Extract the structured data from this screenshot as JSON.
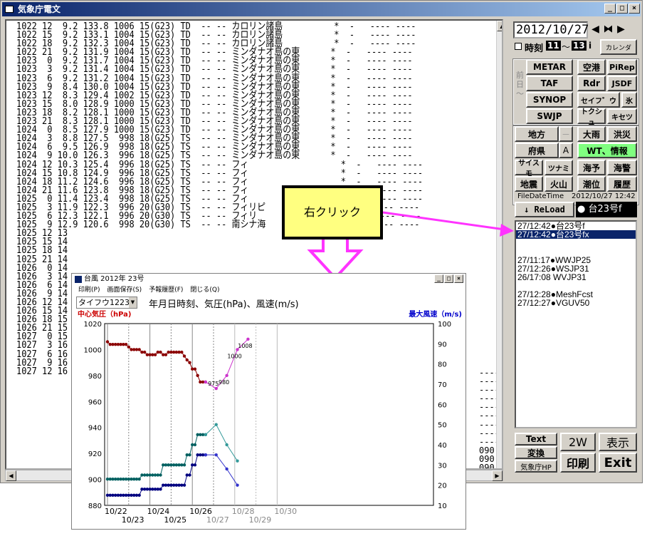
{
  "window": {
    "title": "気象庁電文",
    "buttons": [
      "_",
      "□",
      "×"
    ]
  },
  "text_lines": [
    "1022 12  9.2 133.8 1006 15(G23) TD  -- -- カロリン諸島          *  -   ---- ----",
    "1022 15  9.2 133.1 1004 15(G23) TD  -- -- カロリン諸島          *  -   ---- ----",
    "1022 18  9.2 132.3 1004 15(G23) TD  -- -- カロリン諸島          *  -   ---- ----",
    "1022 21  9.2 131.9 1004 15(G23) TD  -- -- ミンダナオ島の東      *  -   ---- ----",
    "1023  0  9.2 131.7 1004 15(G23) TD  -- -- ミンダナオ島の東      *  -   ---- ----",
    "1023  3  9.2 131.4 1004 15(G23) TD  -- -- ミンダナオ島の東      *  -   ---- ----",
    "1023  6  9.2 131.2 1004 15(G23) TD  -- -- ミンダナオ島の東      *  -   ---- ----",
    "1023  9  8.4 130.0 1004 15(G23) TD  -- -- ミンダナオ島の東      *  -   ---- ----",
    "1023 12  8.3 129.4 1002 15(G23) TD  -- -- ミンダナオ島の東      *  -   ---- ----",
    "1023 15  8.0 128.9 1000 15(G23) TD  -- -- ミンダナオ島の東      *  -   ---- ----",
    "1023 18  8.2 128.1 1000 15(G23) TD  -- -- ミンダナオ島の東      *  -   ---- ----",
    "1023 21  8.3 128.1 1000 15(G23) TD  -- -- ミンダナオ島の東      *  -   ---- ----",
    "1024  0  8.5 127.9 1000 15(G23) TD  -- -- ミンダナオ島の東      *  -   ---- ----",
    "1024  3  8.8 127.5  998 18(G25) TS  -- -- ミンダナオ島の東      *  -   ---- ----",
    "1024  6  9.5 126.9  998 18(G25) TS  -- -- ミンダナオ島の東      *  -   ---- ----",
    "1024  9 10.0 126.3  996 18(G25) TS  -- -- ミンダナオ島の東      *  -   ---- ----",
    "1024 12 10.3 125.4  996 18(G25) TS  -- -- フィ                  *  -   ---- ----",
    "1024 15 10.8 124.9  996 18(G25) TS  -- -- フィ                  *  -   ---- ----",
    "1024 18 11.2 124.6  996 18(G25) TS  -- -- フィ                  *  -   ---- ----",
    "1024 21 11.6 123.8  998 18(G25) TS  -- -- フィ                  *  -   ---- ----",
    "1025  0 11.4 123.4  998 18(G25) TS  -- -- フィ                  *  -   ---- ----",
    "1025  3 11.9 122.3  996 20(G30) TS  -- -- フィリピ              *  -   ---- ----",
    "1025  6 12.3 122.1  996 20(G30) TS  -- -- フィリ                *  -   ---- ----",
    "1025  9 12.9 120.6  998 20(G30) TS  -- -- 南シナ海              *  -   ---- ----",
    "1025 12 13",
    "1025 15 14",
    "1025 18 14",
    "1025 21 14",
    "1026  0 14",
    "1026  3 14",
    "1026  6 14",
    "1026  9 14",
    "1026 12 14",
    "1026 15 14",
    "1026 18 15",
    "1026 21 15",
    "1027  0 15",
    "1027  3 16",
    "1027  6 16",
    "1027  9 16",
    "1027 12 16"
  ],
  "right_tail": [
    "----",
    "----",
    "----",
    "----",
    "----",
    "----",
    "----",
    "----",
    "----",
    "090",
    "090",
    "090",
    "090",
    "090",
    "090",
    "090",
    "090"
  ],
  "panel": {
    "date": "2012/10/27",
    "time_label": "時刻",
    "time_from": "11",
    "time_to": "13",
    "tilde": "～",
    "info": "i",
    "calendar": "カレンダ",
    "prev_day": "前日～",
    "metar": "METAR",
    "airport": "空港",
    "pirep": "PiRep",
    "taf": "TAF",
    "rdr": "Rdr",
    "jsdf": "JSDF",
    "synop": "SYNOP",
    "seifu": "セイフ゛ウ",
    "ice": "氷",
    "swjp": "SWJP",
    "toshu": "トクシュ",
    "kisetsu": "キセツ",
    "chiho": "地方",
    "dash": "－",
    "heavy_rain": "大雨",
    "flood": "洪災",
    "fuken": "府県",
    "a": "A",
    "wt_info": "WT、情報",
    "size": "サイスモ",
    "tsunami": "ツナミ",
    "kaiyo": "海予",
    "kaikei": "海警",
    "earthquake": "地震",
    "volcano": "火山",
    "tide": "潮位",
    "history": "履歴",
    "file_label": "FileDateTime",
    "file_time": "2012/10/27 12:42",
    "reload": "↓ ReLoad",
    "badge": "● 台23号f",
    "list": [
      {
        "text": "27/12:42●台23号f",
        "sel": false
      },
      {
        "text": "27/12:42●台23号fx",
        "sel": true
      },
      {
        "text": "",
        "sel": false
      },
      {
        "text": "",
        "sel": false
      },
      {
        "text": "27/11:17●WWJP25",
        "sel": false
      },
      {
        "text": "27/12:26●WSJP31",
        "sel": false
      },
      {
        "text": "26/17:08   WVJP31",
        "sel": false
      },
      {
        "text": "",
        "sel": false
      },
      {
        "text": "27/12:28●MeshFcst",
        "sel": false
      },
      {
        "text": "27/12:27●VGUV50",
        "sel": false
      }
    ],
    "text_btn": "Text",
    "convert": "変換",
    "jma_hp": "気象庁HP",
    "two_w": "2W",
    "print": "印刷",
    "display": "表示",
    "exit": "Exit"
  },
  "callout": {
    "text": "右クリック"
  },
  "arrow_color": "#ff33ff",
  "typhoon_window": {
    "title": "台風  2012年  23号",
    "menu": [
      "印刷(P)",
      "画面保存(S)",
      "予報履歴(F)",
      "閉じる(Q)"
    ],
    "select": "タイフウ1223",
    "description": "年月日時刻、気圧(hPa)、風速(m/s)"
  },
  "chart_data": {
    "type": "line",
    "left_axis_label": "中心気圧（hPa)",
    "right_axis_label": "最大風速（m/s)",
    "ylim_left": [
      880,
      1020
    ],
    "ylim_right": [
      10,
      100
    ],
    "y_ticks_left": [
      880,
      900,
      920,
      940,
      960,
      980,
      1000,
      1020
    ],
    "y_ticks_right": [
      10,
      20,
      30,
      40,
      50,
      60,
      70,
      80,
      90,
      100
    ],
    "x_ticks_top": [
      "10/22",
      "10/24",
      "10/26",
      "10/28",
      "10/30"
    ],
    "x_ticks_bottom": [
      "10/23",
      "10/25",
      "10/27",
      "10/29"
    ],
    "grid": true,
    "pressure": [
      1006,
      1004,
      1004,
      1004,
      1004,
      1004,
      1004,
      1004,
      1002,
      1000,
      1000,
      1000,
      1000,
      998,
      998,
      996,
      996,
      996,
      996,
      998,
      998,
      996,
      996,
      998,
      998,
      998,
      998,
      998,
      998,
      995,
      992,
      990,
      985,
      985,
      980,
      975,
      975,
      975
    ],
    "forecast_pressure": [
      970,
      980,
      1000,
      1008
    ],
    "forecast_pressure_labels": [
      "975",
      "980",
      "1000",
      "1008"
    ],
    "wind": [
      15,
      15,
      15,
      15,
      15,
      15,
      15,
      15,
      15,
      15,
      15,
      15,
      15,
      18,
      18,
      18,
      18,
      18,
      18,
      18,
      18,
      20,
      20,
      20,
      20,
      20,
      20,
      20,
      20,
      20,
      25,
      25,
      30,
      30,
      35,
      35,
      35,
      35
    ],
    "gust": [
      23,
      23,
      23,
      23,
      23,
      23,
      23,
      23,
      23,
      23,
      23,
      23,
      23,
      25,
      25,
      25,
      25,
      25,
      25,
      25,
      25,
      30,
      30,
      30,
      30,
      30,
      30,
      30,
      30,
      30,
      35,
      35,
      40,
      40,
      45,
      45,
      45,
      45
    ],
    "forecast_wind": [
      35,
      28,
      20
    ],
    "forecast_gust": [
      50,
      40,
      32
    ],
    "colors": {
      "pressure": "#8b0000",
      "forecast_pressure": "#cc33cc",
      "wind": "#000080",
      "gust": "#006060",
      "forecast_wind": "#3333cc",
      "forecast_gust": "#339999"
    }
  }
}
